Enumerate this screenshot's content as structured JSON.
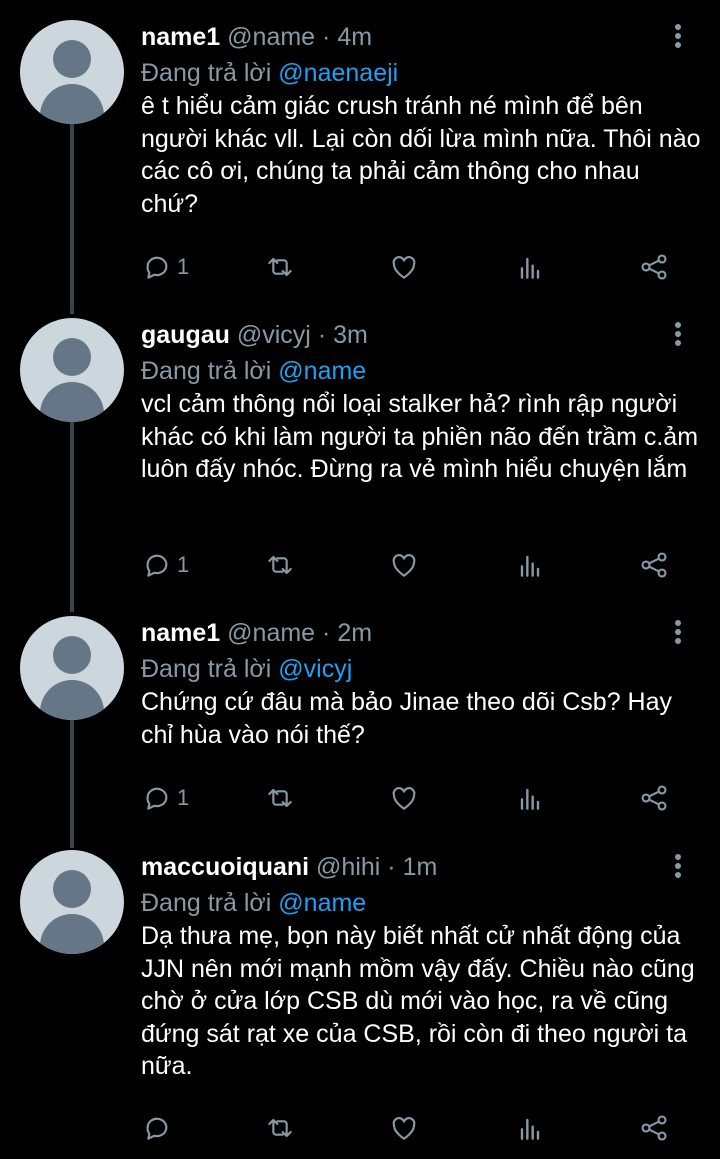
{
  "tweets": [
    {
      "name": "name1",
      "handle": "@name",
      "dot": "·",
      "time": "4m",
      "reply_prefix": "Đang trả lời",
      "reply_to": "@naenaeji",
      "text": "ê t hiểu cảm giác crush tránh né mình để bên người khác vll. Lại còn dối lừa mình nữa. Thôi nào các cô ơi, chúng ta phải cảm thông cho nhau chứ?",
      "reply_count": "1"
    },
    {
      "name": "gaugau",
      "handle": "@vicyj",
      "dot": "·",
      "time": "3m",
      "reply_prefix": "Đang trả lời",
      "reply_to": "@name",
      "text": "vcl cảm thông nổi loại stalker hả? rình rập người khác có khi làm người ta phiền não đến trầm c.ảm luôn đấy nhóc. Đừng ra vẻ mình hiểu chuyện lắm",
      "reply_count": "1"
    },
    {
      "name": "name1",
      "handle": "@name",
      "dot": "·",
      "time": "2m",
      "reply_prefix": "Đang trả lời",
      "reply_to": "@vicyj",
      "text": "Chứng cứ đâu mà bảo Jinae theo dõi Csb? Hay chỉ hùa vào nói thế?",
      "reply_count": "1"
    },
    {
      "name": "maccuoiquani",
      "handle": "@hihi",
      "dot": "·",
      "time": "1m",
      "reply_prefix": "Đang trả lời",
      "reply_to": "@name",
      "text": "Dạ thưa mẹ, bọn này biết nhất cử nhất động của JJN nên mới mạnh mồm vậy đấy. Chiều nào cũng chờ ở cửa lớp CSB dù mới vào học, ra về cũng đứng sát rạt xe của CSB, rồi còn đi theo người ta nữa.",
      "reply_count": ""
    }
  ],
  "icons": [
    "reply-icon",
    "retweet-icon",
    "like-icon",
    "analytics-icon",
    "share-icon",
    "more-icon"
  ],
  "colors": {
    "background": "#000000",
    "text": "#ffffff",
    "muted": "#8899a6",
    "mention": "#1da1f2",
    "thread_line": "#38444d"
  }
}
